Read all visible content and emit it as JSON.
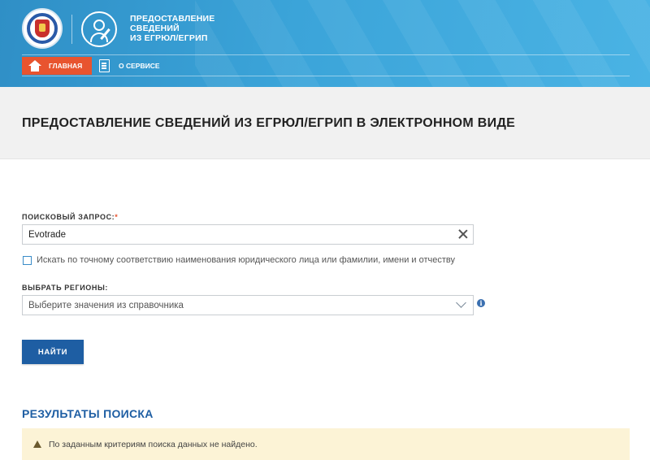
{
  "header": {
    "service_title_lines": [
      "ПРЕДОСТАВЛЕНИЕ",
      "СВЕДЕНИЙ",
      "ИЗ ЕГРЮЛ/ЕГРИП"
    ],
    "nav": {
      "home_label": "ГЛАВНАЯ",
      "about_label": "О СЕРВИСЕ"
    },
    "accent_color": "#e8542f",
    "brand_color": "#3ba4d9"
  },
  "page": {
    "title": "ПРЕДОСТАВЛЕНИЕ СВЕДЕНИЙ ИЗ ЕГРЮЛ/ЕГРИП В ЭЛЕКТРОННОМ ВИДЕ"
  },
  "form": {
    "search_label": "ПОИСКОВЫЙ ЗАПРОС:",
    "required_mark": "*",
    "search_value": "Evotrade",
    "exact_match_label": "Искать по точному соответствию наименования юридического лица или фамилии, имени и отчеству",
    "exact_match_checked": false,
    "region_label": "ВЫБРАТЬ РЕГИОНЫ:",
    "region_placeholder": "Выберите значения из справочника",
    "info_icon_glyph": "i",
    "submit_label": "НАЙТИ"
  },
  "results": {
    "title": "РЕЗУЛЬТАТЫ ПОИСКА",
    "message": "По заданным критериям поиска данных не найдено."
  },
  "icons": [
    "emblem-icon",
    "service-icon",
    "home-icon",
    "document-icon",
    "clear-icon",
    "chevron-down-icon",
    "info-icon",
    "warning-icon"
  ]
}
